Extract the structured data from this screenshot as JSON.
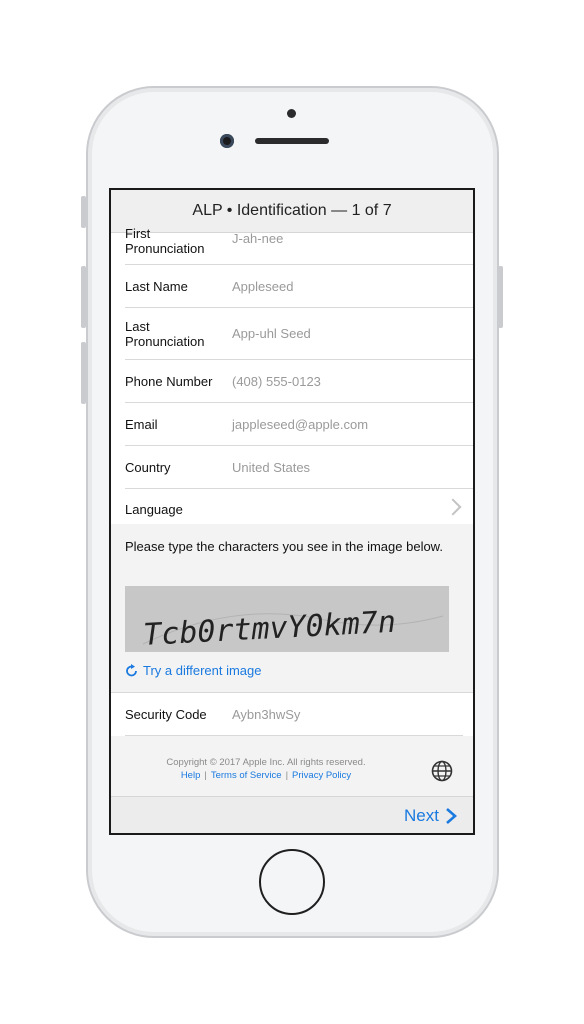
{
  "header": {
    "title": "ALP • Identification — 1 of 7"
  },
  "form": {
    "first_pronunciation": {
      "label": "First\nPronunciation",
      "value": "J-ah-nee"
    },
    "last_name": {
      "label": "Last Name",
      "placeholder": "Appleseed"
    },
    "last_pronunciation": {
      "label": "Last\nPronunciation",
      "placeholder": "App-uhl Seed"
    },
    "phone": {
      "label": "Phone Number",
      "placeholder": "(408) 555-0123"
    },
    "email": {
      "label": "Email",
      "placeholder": "jappleseed@apple.com"
    },
    "country": {
      "label": "Country",
      "value": "United States"
    },
    "language": {
      "label": "Language"
    }
  },
  "captcha": {
    "instructions": "Please type the characters you see in the image below.",
    "image_text": "Tcb0rtmvY0km7n",
    "try_different": "Try a different image"
  },
  "security": {
    "label": "Security Code",
    "placeholder": "Aybn3hwSy"
  },
  "footer": {
    "copyright": "Copyright © 2017 Apple Inc. All rights reserved.",
    "links": [
      "Help",
      "Terms of Service",
      "Privacy Policy"
    ]
  },
  "nav": {
    "next_label": "Next"
  },
  "colors": {
    "accent": "#1a7ae0",
    "placeholder": "#9a9a9a",
    "bar": "#efefef"
  }
}
